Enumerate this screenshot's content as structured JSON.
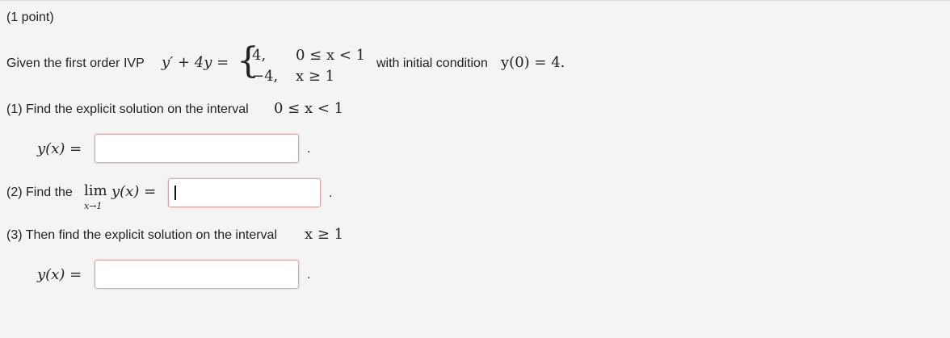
{
  "problem": {
    "points": "(1 point)",
    "intro_prefix": "Given the first order IVP",
    "lhs": "y′ + 4y =",
    "piecewise": {
      "row1_value": "4,",
      "row1_condition": "0 ≤ x < 1",
      "row2_value": "−4,",
      "row2_condition": "x ≥ 1"
    },
    "intro_suffix": "with initial condition",
    "initial_condition": "y(0) = 4."
  },
  "part1": {
    "prompt": "(1) Find the explicit solution on the interval",
    "interval": "0 ≤ x < 1",
    "answer_label": "y(x) =",
    "answer_value": "",
    "trailing": "."
  },
  "part2": {
    "prompt": "(2) Find the",
    "lim": "lim",
    "lim_sub": "x→1",
    "expression": "y(x) =",
    "answer_value": "",
    "trailing": "."
  },
  "part3": {
    "prompt": "(3) Then find the explicit solution on the interval",
    "interval": "x ≥ 1",
    "answer_label": "y(x) =",
    "answer_value": "",
    "trailing": "."
  }
}
